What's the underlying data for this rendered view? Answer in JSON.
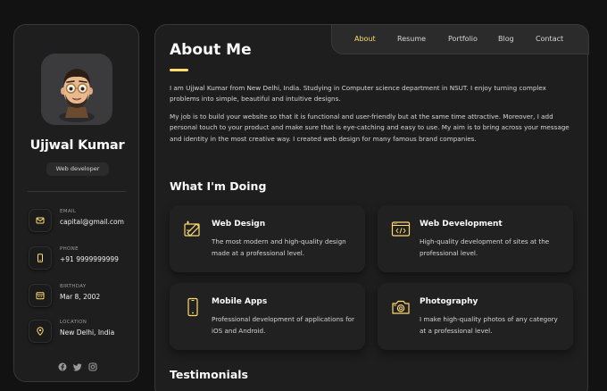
{
  "profile": {
    "name": "Ujjwal Kumar",
    "title": "Web developer"
  },
  "contacts": [
    {
      "label": "EMAIL",
      "value": "capital@gmail.com",
      "icon": "mail-icon"
    },
    {
      "label": "PHONE",
      "value": "+91 9999999999",
      "icon": "phone-icon"
    },
    {
      "label": "BIRTHDAY",
      "value": "Mar 8, 2002",
      "icon": "calendar-icon"
    },
    {
      "label": "LOCATION",
      "value": "New Delhi, India",
      "icon": "location-pin-icon"
    }
  ],
  "socials": [
    "facebook-icon",
    "twitter-icon",
    "instagram-icon"
  ],
  "nav": {
    "items": [
      "About",
      "Resume",
      "Portfolio",
      "Blog",
      "Contact"
    ],
    "active": "About"
  },
  "about": {
    "heading": "About Me",
    "paragraphs": [
      "I am Ujjwal Kumar from New Delhi, India. Studying in Computer science department in NSUT. I enjoy turning complex problems into simple, beautiful and intuitive designs.",
      "My job is to build your website so that it is functional and user-friendly but at the same time attractive. Moreover, I add personal touch to your product and make sure that is eye-catching and easy to use. My aim is to bring across your message and identity in the most creative way. I created web design for many famous brand companies."
    ]
  },
  "doing": {
    "heading": "What I'm Doing",
    "services": [
      {
        "title": "Web Design",
        "desc": "The most modern and high-quality design made at a professional level.",
        "icon": "web-design-icon"
      },
      {
        "title": "Web Development",
        "desc": "High-quality development of sites at the professional level.",
        "icon": "web-development-icon"
      },
      {
        "title": "Mobile Apps",
        "desc": "Professional development of applications for iOS and Android.",
        "icon": "mobile-icon"
      },
      {
        "title": "Photography",
        "desc": "I make high-quality photos of any category at a professional level.",
        "icon": "camera-icon"
      }
    ]
  },
  "testimonials": {
    "heading": "Testimonials"
  },
  "colors": {
    "accent": "#ffdb70",
    "background": "#121212",
    "card": "#1e1e1f",
    "text": "#d6d6d6"
  }
}
